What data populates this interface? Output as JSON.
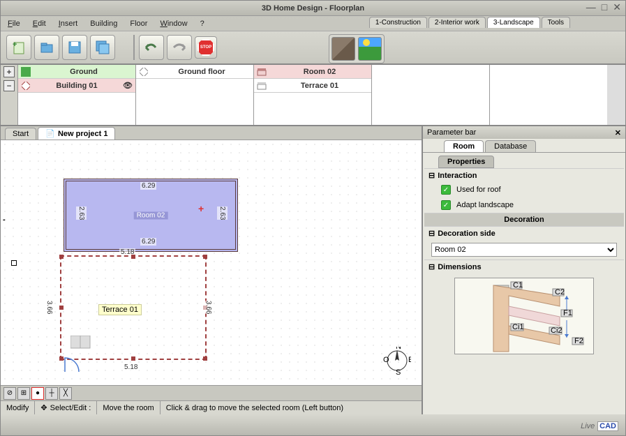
{
  "window": {
    "title": "3D Home Design - Floorplan"
  },
  "menu": {
    "file": "File",
    "edit": "Edit",
    "insert": "Insert",
    "building": "Building",
    "floor": "Floor",
    "window": "Window",
    "help": "?"
  },
  "topTabs": {
    "t1": "1-Construction",
    "t2": "2-Interior work",
    "t3": "3-Landscape",
    "t4": "Tools"
  },
  "stop": "STOP",
  "hierarchy": {
    "col0": {
      "ground": "Ground",
      "building": "Building 01"
    },
    "col1": {
      "groundfloor": "Ground floor"
    },
    "col2": {
      "room": "Room 02",
      "terrace": "Terrace 01"
    }
  },
  "canvasTabs": {
    "start": "Start",
    "project": "New project 1"
  },
  "floorplan": {
    "room_label": "Room 02",
    "terrace_label": "Terrace 01",
    "dim_top": "6.29",
    "dim_bottom": "6.29",
    "dim_left": "2.63",
    "dim_right": "2.63",
    "dim_518a": "5.18",
    "dim_518b": "5.18",
    "dim_366l": "3.66",
    "dim_366r": "3.66",
    "compass": {
      "n": "N",
      "s": "S",
      "e": "E",
      "o": "O"
    }
  },
  "status": {
    "modify": "Modify",
    "select": "Select/Edit :",
    "move": "Move the room",
    "hint": "Click & drag to move the selected room (Left button)"
  },
  "param": {
    "title": "Parameter bar",
    "tab_room": "Room",
    "tab_db": "Database",
    "tab_props": "Properties",
    "sec_interaction": "Interaction",
    "used_roof": "Used for roof",
    "adapt_land": "Adapt landscape",
    "sec_decoration": "Decoration",
    "sec_decside": "Decoration side",
    "select_value": "Room 02",
    "sec_dimensions": "Dimensions",
    "diag": {
      "c1": "C1",
      "c2": "C2",
      "f1": "F1",
      "f2": "F2",
      "ci1": "Ci1",
      "ci2": "Ci2"
    }
  },
  "branding": {
    "live": "Live",
    "cad": "CAD"
  }
}
